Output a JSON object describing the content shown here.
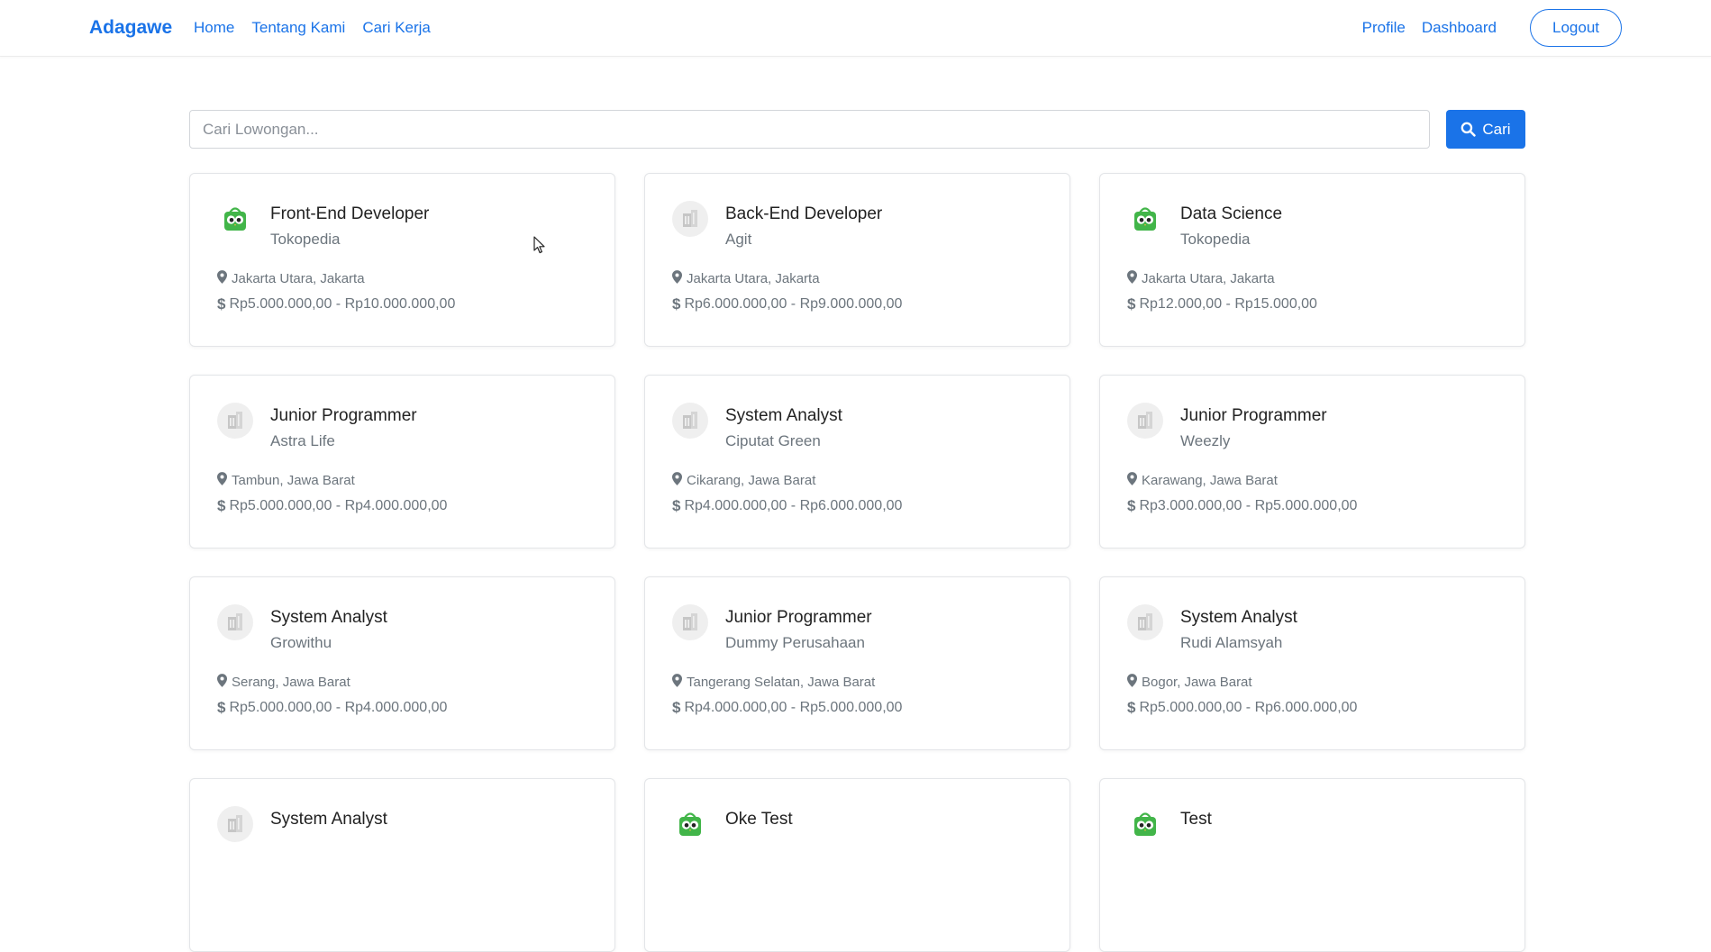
{
  "navbar": {
    "brand": "Adagawe",
    "links": [
      "Home",
      "Tentang Kami",
      "Cari Kerja"
    ],
    "right_links": [
      "Profile",
      "Dashboard"
    ],
    "logout": "Logout"
  },
  "search": {
    "placeholder": "Cari Lowongan...",
    "button_label": "Cari"
  },
  "colors": {
    "primary": "#1a73e8",
    "tokopedia_green": "#42b549"
  },
  "jobs": [
    {
      "title": "Front-End Developer",
      "company": "Tokopedia",
      "location": "Jakarta Utara, Jakarta",
      "salary": "Rp5.000.000,00 - Rp10.000.000,00",
      "logo": "tokopedia-logo"
    },
    {
      "title": "Back-End Developer",
      "company": "Agit",
      "location": "Jakarta Utara, Jakarta",
      "salary": "Rp6.000.000,00 - Rp9.000.000,00",
      "logo": "building-icon"
    },
    {
      "title": "Data Science",
      "company": "Tokopedia",
      "location": "Jakarta Utara, Jakarta",
      "salary": "Rp12.000,00 - Rp15.000,00",
      "logo": "tokopedia-logo"
    },
    {
      "title": "Junior Programmer",
      "company": "Astra Life",
      "location": "Tambun, Jawa Barat",
      "salary": "Rp5.000.000,00 - Rp4.000.000,00",
      "logo": "building-icon"
    },
    {
      "title": "System Analyst",
      "company": "Ciputat Green",
      "location": "Cikarang, Jawa Barat",
      "salary": "Rp4.000.000,00 - Rp6.000.000,00",
      "logo": "building-icon"
    },
    {
      "title": "Junior Programmer",
      "company": "Weezly",
      "location": "Karawang, Jawa Barat",
      "salary": "Rp3.000.000,00 - Rp5.000.000,00",
      "logo": "building-icon"
    },
    {
      "title": "System Analyst",
      "company": "Growithu",
      "location": "Serang, Jawa Barat",
      "salary": "Rp5.000.000,00 - Rp4.000.000,00",
      "logo": "building-icon"
    },
    {
      "title": "Junior Programmer",
      "company": "Dummy Perusahaan",
      "location": "Tangerang Selatan, Jawa Barat",
      "salary": "Rp4.000.000,00 - Rp5.000.000,00",
      "logo": "building-icon"
    },
    {
      "title": "System Analyst",
      "company": "Rudi Alamsyah",
      "location": "Bogor, Jawa Barat",
      "salary": "Rp5.000.000,00 - Rp6.000.000,00",
      "logo": "building-icon"
    },
    {
      "title": "System Analyst",
      "company": "",
      "location": "",
      "salary": "",
      "logo": "building-icon"
    },
    {
      "title": "Oke Test",
      "company": "",
      "location": "",
      "salary": "",
      "logo": "tokopedia-logo"
    },
    {
      "title": "Test",
      "company": "",
      "location": "",
      "salary": "",
      "logo": "tokopedia-logo"
    }
  ]
}
